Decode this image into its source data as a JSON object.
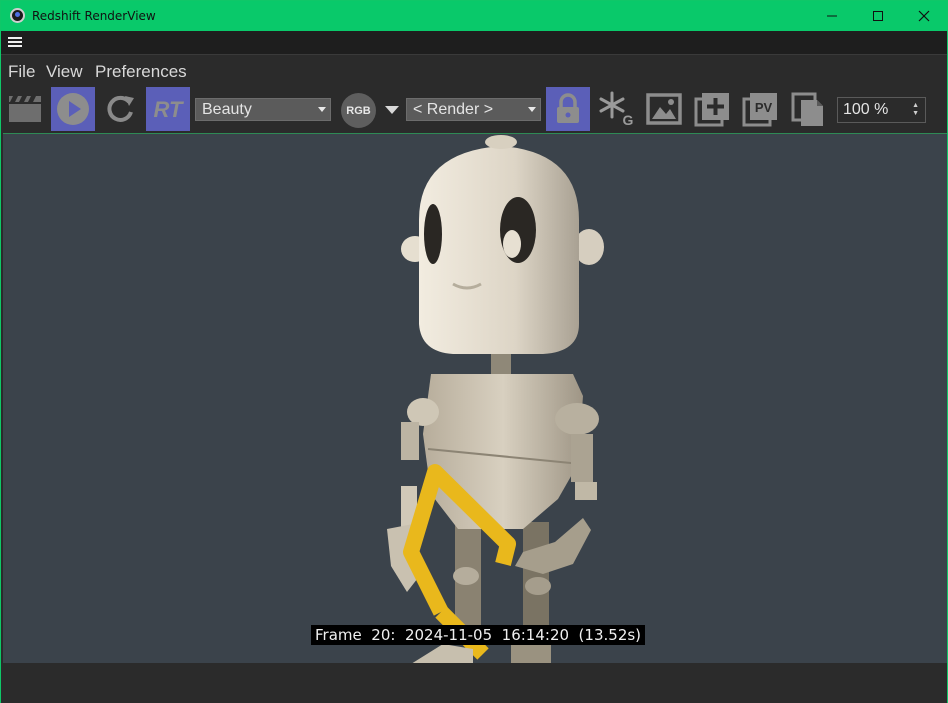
{
  "window": {
    "title": "Redshift RenderView",
    "controls": {
      "minimize": "—",
      "maximize": "☐",
      "close": "✕"
    }
  },
  "menu": {
    "items": [
      "File",
      "View",
      "Preferences"
    ]
  },
  "toolbar": {
    "buttons": [
      {
        "icon": "clapperboard-icon"
      },
      {
        "icon": "play-icon",
        "active": true
      },
      {
        "icon": "refresh-icon"
      },
      {
        "icon": "rt-icon",
        "label": "RT",
        "active": true
      },
      {
        "icon": "lock-icon",
        "active": true
      },
      {
        "icon": "snowflake-g-icon",
        "label": "G"
      },
      {
        "icon": "image-icon"
      },
      {
        "icon": "add-snapshot-icon"
      },
      {
        "icon": "pv-icon",
        "label": "PV"
      },
      {
        "icon": "copy-icon"
      }
    ],
    "aov_select": {
      "value": "Beauty"
    },
    "rgb_button": {
      "label": "RGB"
    },
    "render_select": {
      "value": "< Render >"
    },
    "zoom": {
      "value": "100 %"
    }
  },
  "viewport": {
    "frame_label": "Frame  20:  2024-11-05  16:14:20  (13.52s)"
  },
  "colors": {
    "titlebar": "#09c96a",
    "accent_active": "#5b5fb8",
    "viewport_bg": "#3b434b",
    "robot_body": "#d8d0c0",
    "robot_accent": "#f0c020"
  }
}
